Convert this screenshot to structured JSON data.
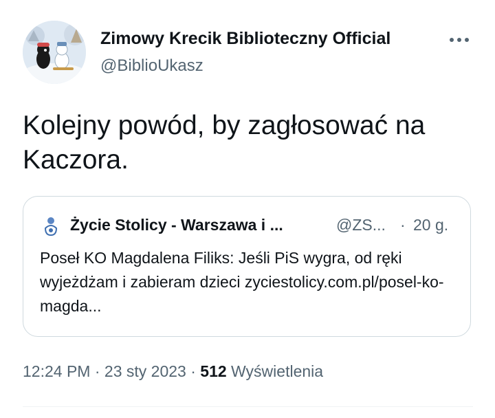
{
  "tweet": {
    "author": {
      "name": "Zimowy Krecik Biblioteczny Official",
      "handle": "@BiblioUkasz"
    },
    "text": "Kolejny powód, by zagłosować na Kaczora.",
    "quoted": {
      "name": "Życie Stolicy - Warszawa i ...",
      "handle": "@ZS...",
      "separator": "·",
      "time": "20 g.",
      "text": "Poseł KO Magdalena Filiks: Jeśli PiS wygra, od ręki wyjeżdżam i zabieram dzieci zyciestolicy.com.pl/posel-ko-magda..."
    },
    "meta": {
      "time": "12:24 PM",
      "sep1": "·",
      "date": "23 sty 2023",
      "sep2": "·",
      "views_count": "512",
      "views_label": "Wyświetlenia"
    }
  },
  "icons": {
    "more": "more-horizontal-icon",
    "quoted_avatar": "zycie-stolicy-logo-icon"
  },
  "colors": {
    "text_primary": "#0f1419",
    "text_secondary": "#536471",
    "border": "#cfd9de"
  }
}
